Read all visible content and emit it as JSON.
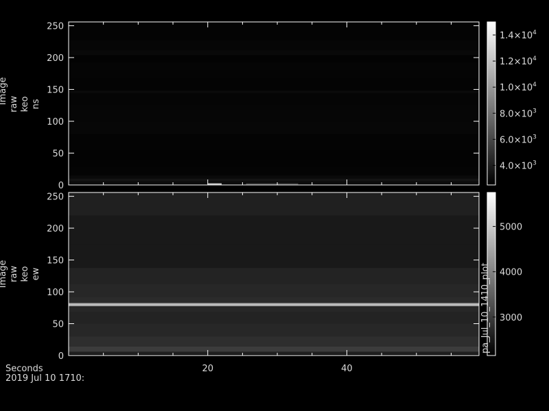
{
  "colors": {
    "background": "#000000",
    "axis": "#ffffff",
    "text": "#dcdcdc"
  },
  "chart_data": [
    {
      "type": "heatmap",
      "ylabel": [
        "Image",
        "raw",
        "keo",
        "ns"
      ],
      "ylim": [
        0,
        256
      ],
      "yticks": [
        0,
        50,
        100,
        150,
        200,
        250
      ],
      "xlim": [
        0,
        59
      ],
      "colorbar": {
        "range": [
          2500,
          15000
        ],
        "ticks": [
          4000,
          6000,
          8000,
          10000,
          12000,
          14000
        ],
        "tick_labels": [
          {
            "mant": "4.0",
            "exp": "3"
          },
          {
            "mant": "6.0",
            "exp": "3"
          },
          {
            "mant": "8.0",
            "exp": "3"
          },
          {
            "mant": "1.0",
            "exp": "4"
          },
          {
            "mant": "1.2",
            "exp": "4"
          },
          {
            "mant": "1.4",
            "exp": "4"
          }
        ]
      },
      "rows": [
        {
          "y": 0,
          "v": 2800
        },
        {
          "y": 4,
          "v": 3100
        },
        {
          "y": 8,
          "v": 3500
        },
        {
          "y": 12,
          "v": 3000
        },
        {
          "y": 18,
          "v": 2700
        },
        {
          "y": 40,
          "v": 2650
        },
        {
          "y": 70,
          "v": 2700
        },
        {
          "y": 90,
          "v": 2850
        },
        {
          "y": 110,
          "v": 2800
        },
        {
          "y": 143,
          "v": 2750
        },
        {
          "y": 146,
          "v": 3050
        },
        {
          "y": 150,
          "v": 2700
        },
        {
          "y": 185,
          "v": 2750
        },
        {
          "y": 200,
          "v": 2650
        },
        {
          "y": 208,
          "v": 2950
        },
        {
          "y": 215,
          "v": 2800
        },
        {
          "y": 240,
          "v": 2700
        },
        {
          "y": 256,
          "v": 2700
        }
      ],
      "features": [
        {
          "x_start": 20.0,
          "x_end": 22.0,
          "y": 1,
          "v": 12000
        },
        {
          "x_start": 25.5,
          "x_end": 33.0,
          "y": 1,
          "v": 5500
        }
      ]
    },
    {
      "type": "heatmap",
      "ylabel": [
        "Image",
        "raw",
        "keo",
        "ew"
      ],
      "ylim": [
        0,
        256
      ],
      "yticks": [
        0,
        50,
        100,
        150,
        200,
        250
      ],
      "xlim": [
        0,
        59
      ],
      "colorbar": {
        "range": [
          2150,
          5750
        ],
        "ticks": [
          3000,
          4000,
          5000
        ],
        "tick_labels": [
          {
            "mant": "3000",
            "exp": ""
          },
          {
            "mant": "4000",
            "exp": ""
          },
          {
            "mant": "5000",
            "exp": ""
          }
        ],
        "side_text": "pa_Jul_10_1410_plot"
      },
      "rows": [
        {
          "y": 0,
          "v": 2250
        },
        {
          "y": 4,
          "v": 2600
        },
        {
          "y": 8,
          "v": 3000
        },
        {
          "y": 20,
          "v": 2800
        },
        {
          "y": 40,
          "v": 2700
        },
        {
          "y": 60,
          "v": 2650
        },
        {
          "y": 76,
          "v": 2700
        },
        {
          "y": 79,
          "v": 4600
        },
        {
          "y": 80,
          "v": 5400
        },
        {
          "y": 81,
          "v": 4600
        },
        {
          "y": 84,
          "v": 2750
        },
        {
          "y": 100,
          "v": 2700
        },
        {
          "y": 125,
          "v": 2650
        },
        {
          "y": 150,
          "v": 2500
        },
        {
          "y": 200,
          "v": 2500
        },
        {
          "y": 240,
          "v": 2600
        },
        {
          "y": 256,
          "v": 2600
        }
      ]
    }
  ],
  "xaxis": {
    "ticks": [
      20,
      40
    ],
    "label": "Seconds",
    "date": "2019 Jul 10 1710:"
  }
}
